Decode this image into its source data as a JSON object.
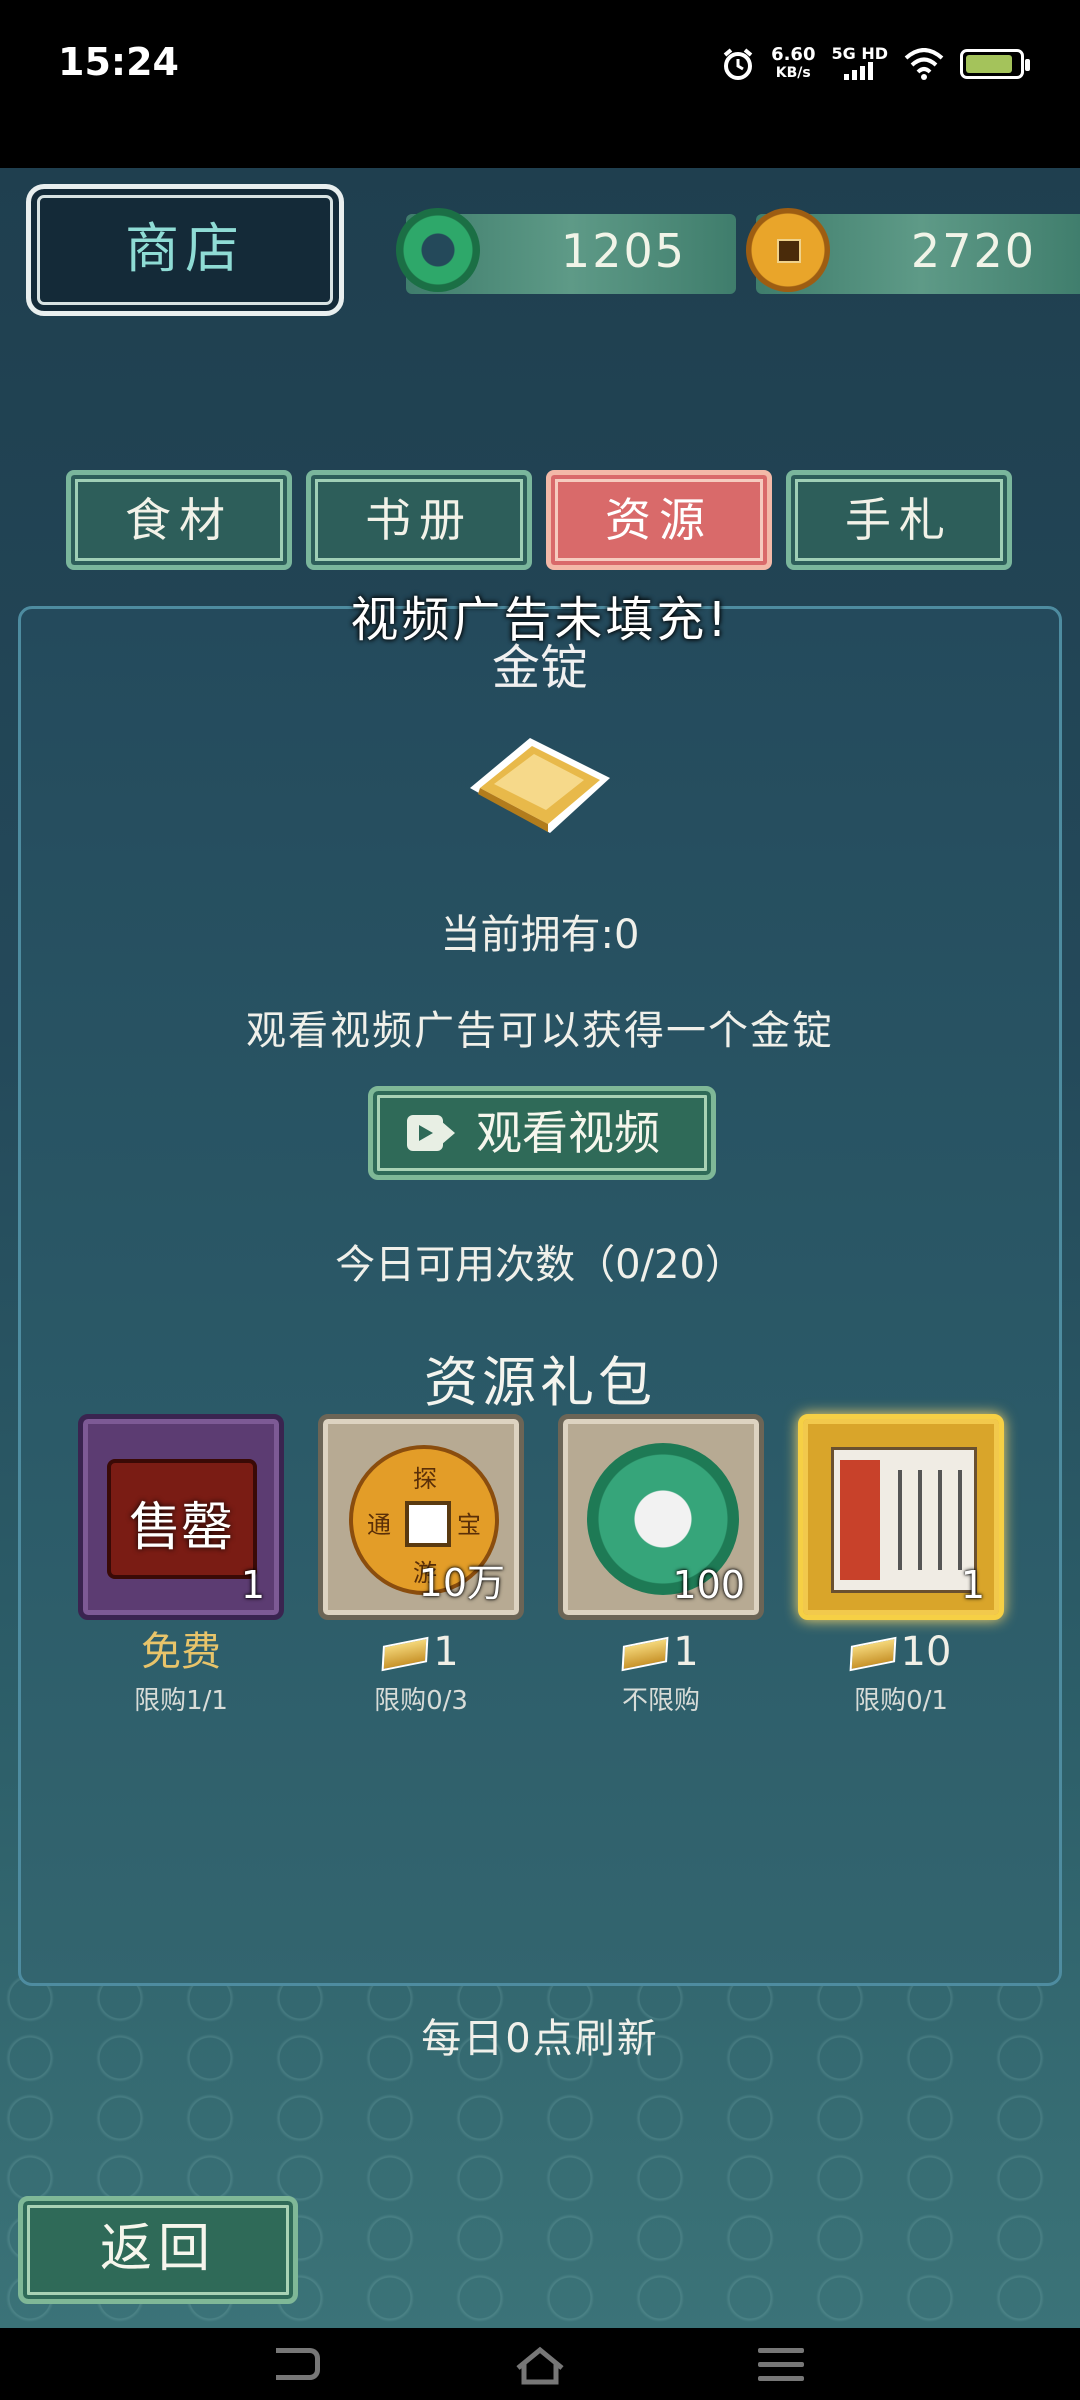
{
  "status_bar": {
    "time": "15:24",
    "net_speed_value": "6.60",
    "net_speed_unit": "KB/s",
    "network": "5G HD"
  },
  "header": {
    "title": "商店",
    "jade_amount": "1205",
    "coin_amount": "2720"
  },
  "tabs": [
    {
      "label": "食材",
      "active": false
    },
    {
      "label": "书册",
      "active": false
    },
    {
      "label": "资源",
      "active": true
    },
    {
      "label": "手札",
      "active": false
    }
  ],
  "notice": "视频广告未填充!",
  "featured": {
    "name": "金锭",
    "owned": "当前拥有:0",
    "description": "观看视频广告可以获得一个金锭",
    "watch_button": "观看视频",
    "daily_uses": "今日可用次数（0/20）"
  },
  "packs_title": "资源礼包",
  "packs": [
    {
      "label": "售罄",
      "count": "1",
      "price": "免费",
      "limit": "限购1/1",
      "style": "purple",
      "icon": "chest-icon"
    },
    {
      "count": "10万",
      "price": "1",
      "limit": "限购0/3",
      "style": "silver",
      "icon": "copper-coin-icon",
      "coin_glyphs": [
        "探",
        "宝",
        "游",
        "通"
      ]
    },
    {
      "count": "100",
      "price": "1",
      "limit": "不限购",
      "style": "silver",
      "icon": "jade-icon"
    },
    {
      "count": "1",
      "price": "10",
      "limit": "限购0/1",
      "style": "gold",
      "icon": "scroll-icon"
    }
  ],
  "refresh_note": "每日0点刷新",
  "back_button": "返回",
  "colors": {
    "active_tab": "#d96a6a",
    "tab_green": "#2d5e5a",
    "title_text": "#8fdcd5",
    "background": "#24495a"
  }
}
